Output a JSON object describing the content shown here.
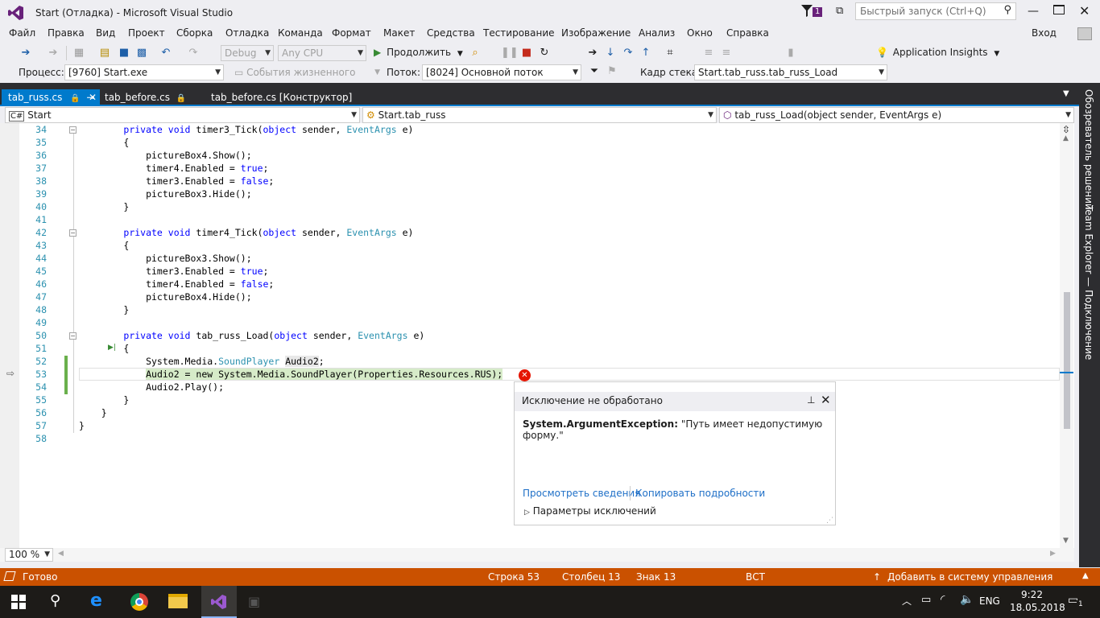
{
  "window": {
    "title": "Start (Отладка) - Microsoft Visual Studio",
    "notif_count": "1",
    "quick_launch_placeholder": "Быстрый запуск (Ctrl+Q)",
    "signin": "Вход"
  },
  "menu": [
    "Файл",
    "Правка",
    "Вид",
    "Проект",
    "Сборка",
    "Отладка",
    "Команда",
    "Формат",
    "Макет",
    "Средства",
    "Тестирование",
    "Изображение",
    "Анализ",
    "Окно",
    "Справка"
  ],
  "toolbar": {
    "config": "Debug",
    "platform": "Any CPU",
    "continue_label": "Продолжить",
    "app_insights": "Application Insights"
  },
  "debugbar": {
    "process_label": "Процесс:",
    "process_value": "[9760] Start.exe",
    "lifecycle": "События жизненного цикла",
    "thread_label": "Поток:",
    "thread_value": "[8024] Основной поток",
    "stackframe_label": "Кадр стека:",
    "stackframe_value": "Start.tab_russ.tab_russ_Load"
  },
  "tabs": [
    {
      "label": "tab_russ.cs",
      "active": true
    },
    {
      "label": "tab_before.cs",
      "active": false
    },
    {
      "label": "tab_before.cs [Конструктор]",
      "active": false
    }
  ],
  "nav": {
    "project": "Start",
    "type": "Start.tab_russ",
    "member": "tab_russ_Load(object sender, EventArgs e)"
  },
  "lines": [
    {
      "n": "34",
      "t": "        private void timer3_Tick(object sender, EventArgs e)"
    },
    {
      "n": "35",
      "t": "        {"
    },
    {
      "n": "36",
      "t": "            pictureBox4.Show();"
    },
    {
      "n": "37",
      "t": "            timer4.Enabled = true;"
    },
    {
      "n": "38",
      "t": "            timer3.Enabled = false;"
    },
    {
      "n": "39",
      "t": "            pictureBox3.Hide();"
    },
    {
      "n": "40",
      "t": "        }"
    },
    {
      "n": "41",
      "t": ""
    },
    {
      "n": "42",
      "t": "        private void timer4_Tick(object sender, EventArgs e)"
    },
    {
      "n": "43",
      "t": "        {"
    },
    {
      "n": "44",
      "t": "            pictureBox3.Show();"
    },
    {
      "n": "45",
      "t": "            timer3.Enabled = true;"
    },
    {
      "n": "46",
      "t": "            timer4.Enabled = false;"
    },
    {
      "n": "47",
      "t": "            pictureBox4.Hide();"
    },
    {
      "n": "48",
      "t": "        }"
    },
    {
      "n": "49",
      "t": ""
    },
    {
      "n": "50",
      "t": "        private void tab_russ_Load(object sender, EventArgs e)"
    },
    {
      "n": "51",
      "t": "        {"
    },
    {
      "n": "52",
      "t": "            System.Media.SoundPlayer Audio2;"
    },
    {
      "n": "53",
      "t": "            Audio2 = new System.Media.SoundPlayer(Properties.Resources.RUS);"
    },
    {
      "n": "54",
      "t": "            Audio2.Play();"
    },
    {
      "n": "55",
      "t": "        }"
    },
    {
      "n": "56",
      "t": "    }"
    },
    {
      "n": "57",
      "t": "}"
    },
    {
      "n": "58",
      "t": ""
    }
  ],
  "exception": {
    "title": "Исключение не обработано",
    "type": "System.ArgumentException:",
    "message": " \"Путь имеет недопустимую форму.\"",
    "view_details": "Просмотреть сведения",
    "copy_details": "Копировать подробности",
    "settings": "Параметры исключений"
  },
  "zoom": "100 %",
  "rightpane": {
    "solution_explorer": "Обозреватель решений",
    "team_explorer": "Team Explorer — Подключение"
  },
  "status": {
    "ready": "Готово",
    "line": "Строка 53",
    "col": "Столбец 13",
    "ch": "Знак 13",
    "mode": "ВСТ",
    "vcs": "Добавить в систему управления версиями"
  },
  "taskbar": {
    "lang": "ENG",
    "time": "9:22",
    "date": "18.05.2018",
    "notifications": "1"
  },
  "colors": {
    "accent": "#007acc",
    "status": "#ca5100",
    "vs_purple": "#68217a"
  }
}
